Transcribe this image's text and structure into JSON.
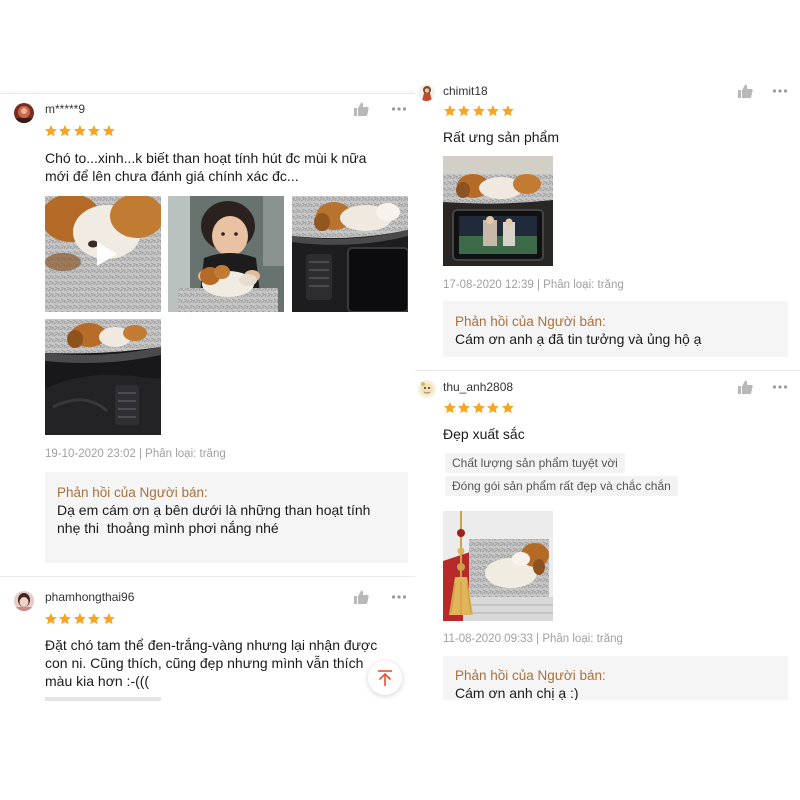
{
  "reviews": [
    {
      "username": "m*****9",
      "rating": 5,
      "comment_lines": [
        "Chó to...xinh...k biết than hoạt tính hút đc mùi k nữa",
        "mới để lên chưa đánh giá chính xác đc..."
      ],
      "meta": "19-10-2020 23:02 | Phân loại: trăng",
      "seller_reply": {
        "label": "Phản hồi của Người bán:",
        "lines": [
          "Dạ em cám ơn ạ bên dưới là những than hoạt tính",
          "nhẹ thi  thoảng mình phơi nắng nhé"
        ]
      }
    },
    {
      "username": "phamhongthai96",
      "rating": 5,
      "comment_lines": [
        "Đặt chó tam thể đen-trắng-vàng nhưng lại nhận được",
        "con ni. Cũng thích, cũng đẹp nhưng mình vẫn thích",
        "màu kia hơn :-((("
      ]
    },
    {
      "username": "chimit18",
      "rating": 5,
      "comment_lines": [
        "Rất ưng sản phẩm"
      ],
      "meta": "17-08-2020 12:39 | Phân loại: trăng",
      "seller_reply": {
        "label": "Phản hồi của Người bán:",
        "lines": [
          "Cám ơn anh ạ đã tin tưởng và ủng hộ ạ"
        ]
      }
    },
    {
      "username": "thu_anh2808",
      "rating": 5,
      "comment_lines": [
        "Đẹp xuất sắc"
      ],
      "tags": [
        "Chất lượng sản phẩm tuyệt vời",
        "Đóng gói sản phẩm rất đẹp và chắc chắn"
      ],
      "meta": "11-08-2020 09:33 | Phân loại: trăng",
      "seller_reply": {
        "label": "Phản hồi của Người bán:",
        "lines": [
          "Cám ơn anh chị ạ :)"
        ]
      }
    }
  ],
  "icons": {
    "like": "thumbs-up-icon",
    "more": "more-options-icon",
    "star": "star-icon",
    "play": "play-icon",
    "scroll_top": "arrow-up-icon"
  },
  "colors": {
    "star": "#f6a623",
    "seller_label": "#a8703e",
    "reply_bg": "#f5f5f5",
    "accent": "#ee4d2d"
  }
}
